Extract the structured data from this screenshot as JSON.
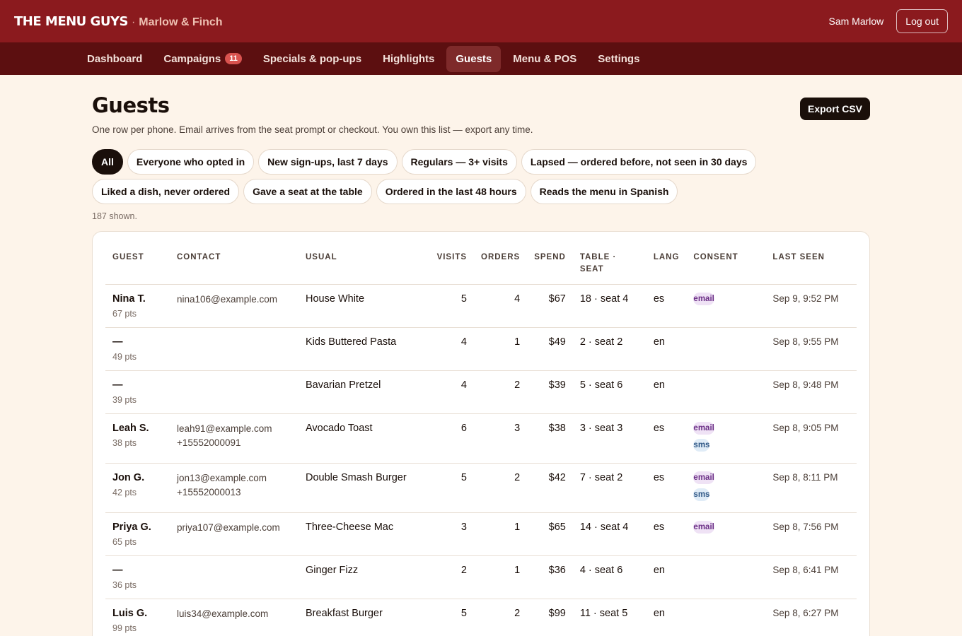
{
  "app": {
    "brand": "THE MENU GUYS",
    "separator": "·",
    "venue": "Marlow & Finch",
    "user_name": "Sam Marlow",
    "logout_label": "Log out"
  },
  "nav": [
    {
      "label": "Dashboard"
    },
    {
      "label": "Campaigns",
      "badge": "11"
    },
    {
      "label": "Specials & pop-ups"
    },
    {
      "label": "Highlights"
    },
    {
      "label": "Guests",
      "active": true
    },
    {
      "label": "Menu & POS"
    },
    {
      "label": "Settings"
    }
  ],
  "page": {
    "title": "Guests",
    "export_label": "Export CSV",
    "subtitle": "One row per phone. Email arrives from the seat prompt or checkout. You own this list — export any time.",
    "shown": "187 shown."
  },
  "filters": [
    {
      "label": "All",
      "active": true
    },
    {
      "label": "Everyone who opted in"
    },
    {
      "label": "New sign-ups, last 7 days"
    },
    {
      "label": "Regulars — 3+ visits"
    },
    {
      "label": "Lapsed — ordered before, not seen in 30 days"
    },
    {
      "label": "Liked a dish, never ordered"
    },
    {
      "label": "Gave a seat at the table"
    },
    {
      "label": "Ordered in the last 48 hours"
    },
    {
      "label": "Reads the menu in Spanish"
    }
  ],
  "table": {
    "headers": {
      "guest": "GUEST",
      "contact": "CONTACT",
      "usual": "USUAL",
      "visits": "VISITS",
      "orders": "ORDERS",
      "spend": "SPEND",
      "table_line1": "TABLE ·",
      "table_line2": "SEAT",
      "lang": "LANG",
      "consent": "CONSENT",
      "last_seen": "LAST SEEN"
    },
    "rows": [
      {
        "name": "Nina T.",
        "pts": "67 pts",
        "email": "nina106@example.com",
        "phone": "",
        "usual": "House White",
        "visits": "5",
        "orders": "4",
        "spend": "$67",
        "seat": "18 · seat 4",
        "lang": "es",
        "consent": [
          "email"
        ],
        "last_seen": "Sep 9, 9:52 PM"
      },
      {
        "name": "—",
        "pts": "49 pts",
        "email": "",
        "phone": "",
        "usual": "Kids Buttered Pasta",
        "visits": "4",
        "orders": "1",
        "spend": "$49",
        "seat": "2 · seat 2",
        "lang": "en",
        "consent": [],
        "last_seen": "Sep 8, 9:55 PM"
      },
      {
        "name": "—",
        "pts": "39 pts",
        "email": "",
        "phone": "",
        "usual": "Bavarian Pretzel",
        "visits": "4",
        "orders": "2",
        "spend": "$39",
        "seat": "5 · seat 6",
        "lang": "en",
        "consent": [],
        "last_seen": "Sep 8, 9:48 PM"
      },
      {
        "name": "Leah S.",
        "pts": "38 pts",
        "email": "leah91@example.com",
        "phone": "+15552000091",
        "usual": "Avocado Toast",
        "visits": "6",
        "orders": "3",
        "spend": "$38",
        "seat": "3 · seat 3",
        "lang": "es",
        "consent": [
          "email",
          "sms"
        ],
        "last_seen": "Sep 8, 9:05 PM"
      },
      {
        "name": "Jon G.",
        "pts": "42 pts",
        "email": "jon13@example.com",
        "phone": "+15552000013",
        "usual": "Double Smash Burger",
        "visits": "5",
        "orders": "2",
        "spend": "$42",
        "seat": "7 · seat 2",
        "lang": "es",
        "consent": [
          "email",
          "sms"
        ],
        "last_seen": "Sep 8, 8:11 PM"
      },
      {
        "name": "Priya G.",
        "pts": "65 pts",
        "email": "priya107@example.com",
        "phone": "",
        "usual": "Three-Cheese Mac",
        "visits": "3",
        "orders": "1",
        "spend": "$65",
        "seat": "14 · seat 4",
        "lang": "es",
        "consent": [
          "email"
        ],
        "last_seen": "Sep 8, 7:56 PM"
      },
      {
        "name": "—",
        "pts": "36 pts",
        "email": "",
        "phone": "",
        "usual": "Ginger Fizz",
        "visits": "2",
        "orders": "1",
        "spend": "$36",
        "seat": "4 · seat 6",
        "lang": "en",
        "consent": [],
        "last_seen": "Sep 8, 6:41 PM"
      },
      {
        "name": "Luis G.",
        "pts": "99 pts",
        "email": "luis34@example.com",
        "phone": "",
        "usual": "Breakfast Burger",
        "visits": "5",
        "orders": "2",
        "spend": "$99",
        "seat": "11 · seat 5",
        "lang": "en",
        "consent": [],
        "last_seen": "Sep 8, 6:27 PM"
      }
    ]
  }
}
